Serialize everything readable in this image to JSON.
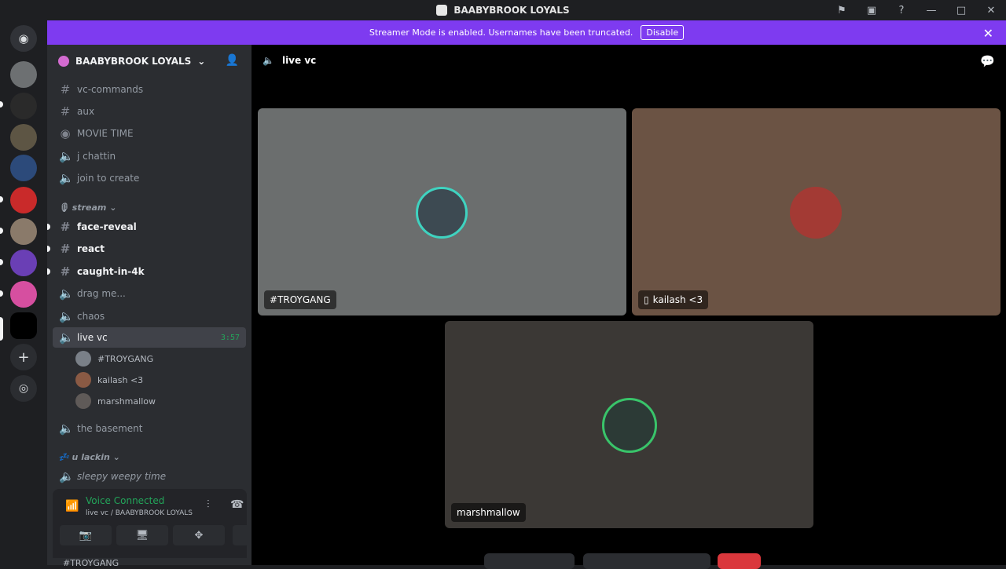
{
  "window": {
    "title": "BAABYBROOK LOYALS"
  },
  "banner": {
    "message": "Streamer Mode is enabled. Usernames have been truncated.",
    "button": "Disable"
  },
  "guild": {
    "name": "BAABYBROOK LOYALS"
  },
  "channels": [
    {
      "name": "vc-commands",
      "type": "text"
    },
    {
      "name": "aux",
      "type": "text"
    },
    {
      "name": "MOVIE TIME",
      "type": "stage"
    },
    {
      "name": "j chattin",
      "type": "voice"
    },
    {
      "name": "join to create",
      "type": "voice"
    }
  ],
  "category_stream": "stream",
  "stream_channels": [
    {
      "name": "face-reveal",
      "type": "text"
    },
    {
      "name": "react",
      "type": "text"
    },
    {
      "name": "caught-in-4k",
      "type": "text"
    },
    {
      "name": "drag me...",
      "type": "voice"
    },
    {
      "name": "chaos",
      "type": "voice"
    }
  ],
  "active_channel": {
    "name": "live vc",
    "time": "3:57"
  },
  "members": [
    "#TROYGANG",
    "kailash <3",
    "marshmallow"
  ],
  "channel_basement": "the basement",
  "category_lackin": "u lackin",
  "channel_sleepy": "sleepy weepy time",
  "voice_panel": {
    "status": "Voice Connected",
    "sub": "live vc / BAABYBROOK LOYALS"
  },
  "user_row": "#TROYGANG",
  "header": {
    "channel": "live vc"
  },
  "tiles": [
    {
      "name": "#TROYGANG"
    },
    {
      "name": "kailash <3"
    },
    {
      "name": "marshmallow"
    }
  ],
  "colors": {
    "accent": "#7e3bf0",
    "connected": "#23a55a"
  }
}
